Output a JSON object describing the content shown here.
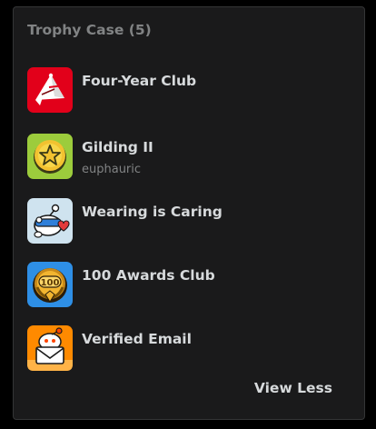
{
  "trophy_case": {
    "title": "Trophy Case (5)",
    "trophies": [
      {
        "name": "Four-Year Club",
        "subtitle": "",
        "icon": "four-year-club-icon",
        "color": "#e2001a"
      },
      {
        "name": "Gilding II",
        "subtitle": "euphauric",
        "icon": "gilding-icon",
        "color": "#9ccc3c"
      },
      {
        "name": "Wearing is Caring",
        "subtitle": "",
        "icon": "wearing-is-caring-icon",
        "color": "#cfe3ef"
      },
      {
        "name": "100 Awards Club",
        "subtitle": "",
        "icon": "hundred-awards-club-icon",
        "color": "#2e8fe6"
      },
      {
        "name": "Verified Email",
        "subtitle": "",
        "icon": "verified-email-icon",
        "color": "#ff8a00"
      }
    ],
    "view_less_label": "View Less"
  }
}
